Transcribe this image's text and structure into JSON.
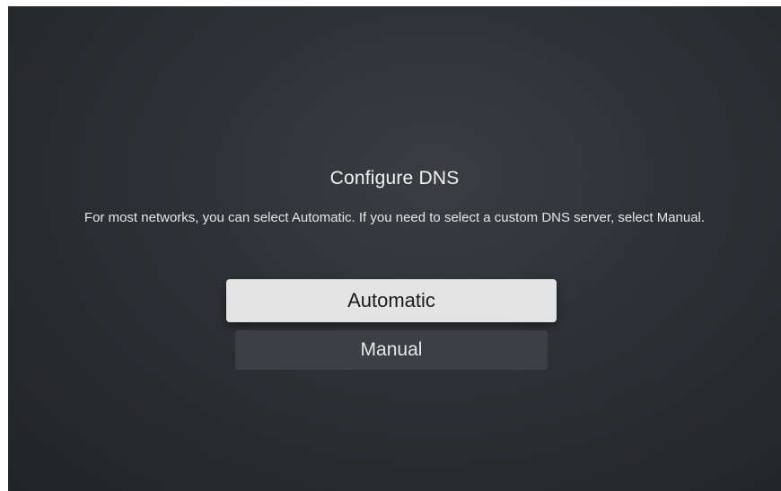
{
  "dialog": {
    "title": "Configure DNS",
    "description": "For most networks, you can select Automatic. If you need to select a custom DNS server, select Manual.",
    "options": [
      {
        "label": "Automatic",
        "focused": true
      },
      {
        "label": "Manual",
        "focused": false
      }
    ]
  },
  "colors": {
    "background": "#2d3034",
    "focused_button": "#e4e4e4",
    "unfocused_button": "#3c3f43"
  }
}
